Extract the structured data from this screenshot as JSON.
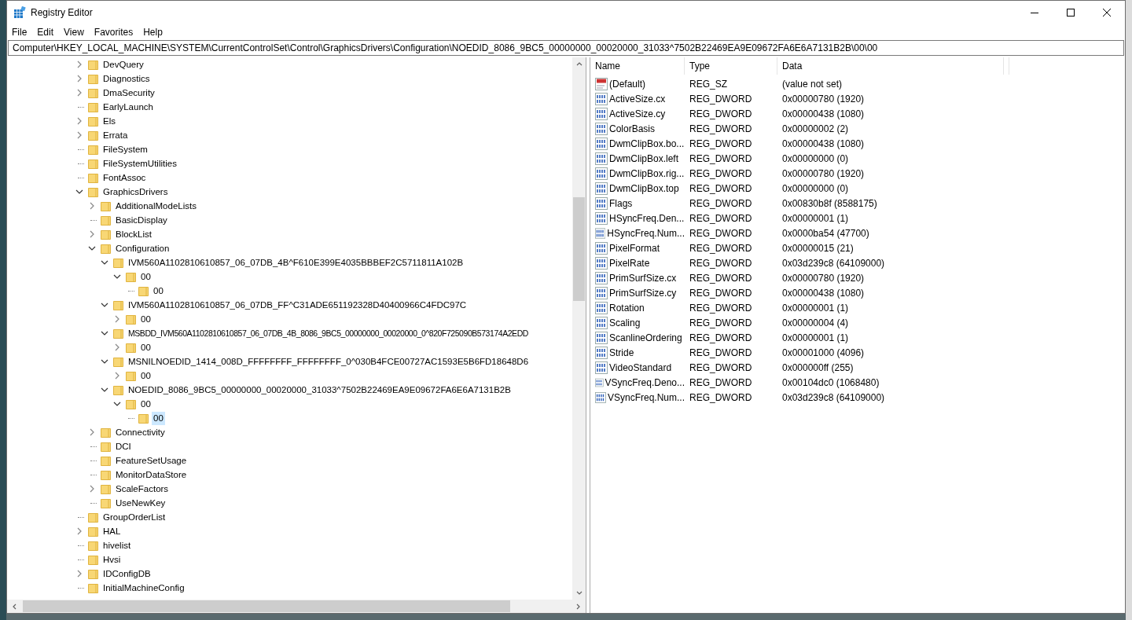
{
  "window": {
    "title": "Registry Editor"
  },
  "menu": [
    {
      "label": "File"
    },
    {
      "label": "Edit"
    },
    {
      "label": "View"
    },
    {
      "label": "Favorites"
    },
    {
      "label": "Help"
    }
  ],
  "address": "Computer\\HKEY_LOCAL_MACHINE\\SYSTEM\\CurrentControlSet\\Control\\GraphicsDrivers\\Configuration\\NOEDID_8086_9BC5_00000000_00020000_31033^7502B22469EA9E09672FA6E6A7131B2B\\00\\00",
  "tree": [
    {
      "label": "DevQuery",
      "kind": "collapsed",
      "selected": false
    },
    {
      "label": "Diagnostics",
      "kind": "collapsed",
      "selected": false
    },
    {
      "label": "DmaSecurity",
      "kind": "collapsed",
      "selected": false
    },
    {
      "label": "EarlyLaunch",
      "kind": "leaf",
      "selected": false
    },
    {
      "label": "Els",
      "kind": "collapsed",
      "selected": false
    },
    {
      "label": "Errata",
      "kind": "collapsed",
      "selected": false
    },
    {
      "label": "FileSystem",
      "kind": "leaf",
      "selected": false
    },
    {
      "label": "FileSystemUtilities",
      "kind": "leaf",
      "selected": false
    },
    {
      "label": "FontAssoc",
      "kind": "leaf",
      "selected": false
    },
    {
      "label": "GraphicsDrivers",
      "kind": "expanded",
      "selected": false,
      "children": [
        {
          "label": "AdditionalModeLists",
          "kind": "collapsed",
          "selected": false
        },
        {
          "label": "BasicDisplay",
          "kind": "leaf",
          "selected": false
        },
        {
          "label": "BlockList",
          "kind": "collapsed",
          "selected": false
        },
        {
          "label": "Configuration",
          "kind": "expanded",
          "selected": false,
          "children": [
            {
              "label": "IVM560A1102810610857_06_07DB_4B^F610E399E4035BBBEF2C5711811A102B",
              "kind": "expanded",
              "selected": false,
              "children": [
                {
                  "label": "00",
                  "kind": "expanded",
                  "selected": false,
                  "children": [
                    {
                      "label": "00",
                      "kind": "leaf",
                      "selected": false
                    }
                  ]
                }
              ]
            },
            {
              "label": "IVM560A1102810610857_06_07DB_FF^C31ADE651192328D40400966C4FDC97C",
              "kind": "expanded",
              "selected": false,
              "children": [
                {
                  "label": "00",
                  "kind": "collapsed",
                  "selected": false
                }
              ]
            },
            {
              "label": "MSBDD_IVM560A1102810610857_06_07DB_4B_8086_9BC5_00000000_00020000_0^820F725090B573174A2EDD",
              "kind": "expanded",
              "selected": false,
              "children": [
                {
                  "label": "00",
                  "kind": "collapsed",
                  "selected": false
                }
              ]
            },
            {
              "label": "MSNILNOEDID_1414_008D_FFFFFFFF_FFFFFFFF_0^030B4FCE00727AC1593E5B6FD18648D6",
              "kind": "expanded",
              "selected": false,
              "children": [
                {
                  "label": "00",
                  "kind": "collapsed",
                  "selected": false
                }
              ]
            },
            {
              "label": "NOEDID_8086_9BC5_00000000_00020000_31033^7502B22469EA9E09672FA6E6A7131B2B",
              "kind": "expanded",
              "selected": false,
              "children": [
                {
                  "label": "00",
                  "kind": "expanded",
                  "selected": false,
                  "children": [
                    {
                      "label": "00",
                      "kind": "leaf",
                      "selected": true
                    }
                  ]
                }
              ]
            }
          ]
        },
        {
          "label": "Connectivity",
          "kind": "collapsed",
          "selected": false
        },
        {
          "label": "DCI",
          "kind": "leaf",
          "selected": false
        },
        {
          "label": "FeatureSetUsage",
          "kind": "leaf",
          "selected": false
        },
        {
          "label": "MonitorDataStore",
          "kind": "leaf",
          "selected": false
        },
        {
          "label": "ScaleFactors",
          "kind": "collapsed",
          "selected": false
        },
        {
          "label": "UseNewKey",
          "kind": "leaf",
          "selected": false
        }
      ]
    },
    {
      "label": "GroupOrderList",
      "kind": "leaf",
      "selected": false
    },
    {
      "label": "HAL",
      "kind": "collapsed",
      "selected": false
    },
    {
      "label": "hivelist",
      "kind": "leaf",
      "selected": false
    },
    {
      "label": "Hvsi",
      "kind": "leaf",
      "selected": false
    },
    {
      "label": "IDConfigDB",
      "kind": "collapsed",
      "selected": false
    },
    {
      "label": "InitialMachineConfig",
      "kind": "leaf",
      "selected": false
    }
  ],
  "values": {
    "columns": [
      "Name",
      "Type",
      "Data"
    ],
    "rows": [
      {
        "name": "(Default)",
        "kind": "string",
        "type": "REG_SZ",
        "data": "(value not set)"
      },
      {
        "name": "ActiveSize.cx",
        "kind": "dword",
        "type": "REG_DWORD",
        "data": "0x00000780 (1920)"
      },
      {
        "name": "ActiveSize.cy",
        "kind": "dword",
        "type": "REG_DWORD",
        "data": "0x00000438 (1080)"
      },
      {
        "name": "ColorBasis",
        "kind": "dword",
        "type": "REG_DWORD",
        "data": "0x00000002 (2)"
      },
      {
        "name": "DwmClipBox.bo...",
        "kind": "dword",
        "type": "REG_DWORD",
        "data": "0x00000438 (1080)"
      },
      {
        "name": "DwmClipBox.left",
        "kind": "dword",
        "type": "REG_DWORD",
        "data": "0x00000000 (0)"
      },
      {
        "name": "DwmClipBox.rig...",
        "kind": "dword",
        "type": "REG_DWORD",
        "data": "0x00000780 (1920)"
      },
      {
        "name": "DwmClipBox.top",
        "kind": "dword",
        "type": "REG_DWORD",
        "data": "0x00000000 (0)"
      },
      {
        "name": "Flags",
        "kind": "dword",
        "type": "REG_DWORD",
        "data": "0x00830b8f (8588175)"
      },
      {
        "name": "HSyncFreq.Den...",
        "kind": "dword",
        "type": "REG_DWORD",
        "data": "0x00000001 (1)"
      },
      {
        "name": "HSyncFreq.Num...",
        "kind": "dword",
        "type": "REG_DWORD",
        "data": "0x0000ba54 (47700)"
      },
      {
        "name": "PixelFormat",
        "kind": "dword",
        "type": "REG_DWORD",
        "data": "0x00000015 (21)"
      },
      {
        "name": "PixelRate",
        "kind": "dword",
        "type": "REG_DWORD",
        "data": "0x03d239c8 (64109000)"
      },
      {
        "name": "PrimSurfSize.cx",
        "kind": "dword",
        "type": "REG_DWORD",
        "data": "0x00000780 (1920)"
      },
      {
        "name": "PrimSurfSize.cy",
        "kind": "dword",
        "type": "REG_DWORD",
        "data": "0x00000438 (1080)"
      },
      {
        "name": "Rotation",
        "kind": "dword",
        "type": "REG_DWORD",
        "data": "0x00000001 (1)"
      },
      {
        "name": "Scaling",
        "kind": "dword",
        "type": "REG_DWORD",
        "data": "0x00000004 (4)"
      },
      {
        "name": "ScanlineOrdering",
        "kind": "dword",
        "type": "REG_DWORD",
        "data": "0x00000001 (1)"
      },
      {
        "name": "Stride",
        "kind": "dword",
        "type": "REG_DWORD",
        "data": "0x00001000 (4096)"
      },
      {
        "name": "VideoStandard",
        "kind": "dword",
        "type": "REG_DWORD",
        "data": "0x000000ff (255)"
      },
      {
        "name": "VSyncFreq.Deno...",
        "kind": "dword",
        "type": "REG_DWORD",
        "data": "0x00104dc0 (1068480)"
      },
      {
        "name": "VSyncFreq.Num...",
        "kind": "dword",
        "type": "REG_DWORD",
        "data": "0x03d239c8 (64109000)"
      }
    ]
  }
}
